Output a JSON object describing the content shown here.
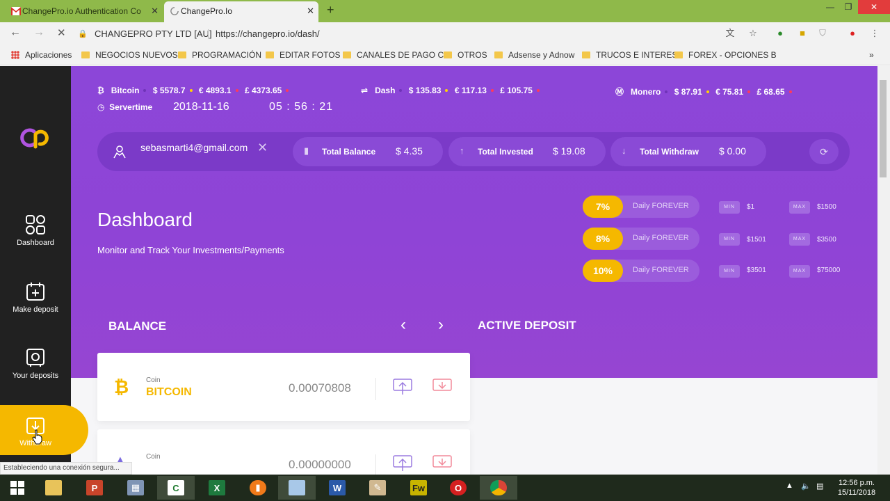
{
  "browser": {
    "tabs": [
      {
        "title": "ChangePro.io Authentication Co",
        "icon": "gmail-icon"
      },
      {
        "title": "ChangePro.Io",
        "icon": "loading-icon"
      }
    ],
    "org": "CHANGEPRO PTY LTD [AU]",
    "url": "https://changepro.io/dash/",
    "bookmarks": [
      "Aplicaciones",
      "NEGOCIOS NUEVOS",
      "PROGRAMACIÓN",
      "EDITAR FOTOS",
      "CANALES DE PAGO C",
      "OTROS",
      "Adsense y Adnow",
      "TRUCOS E INTERES",
      "FOREX - OPCIONES B"
    ],
    "status": "Estableciendo una conexión segura..."
  },
  "ticker": {
    "bitcoin": {
      "name": "Bitcoin",
      "usd": "$ 5578.7",
      "eur": "€ 4893.1",
      "gbp": "£ 4373.65"
    },
    "dash": {
      "name": "Dash",
      "usd": "$ 135.83",
      "eur": "€ 117.13",
      "gbp": "£ 105.75"
    },
    "monero": {
      "name": "Monero",
      "usd": "$ 87.91",
      "eur": "€ 75.81",
      "gbp": "£ 68.65"
    },
    "servertime_label": "Servertime",
    "date": "2018-11-16",
    "time": "05 : 56 : 21"
  },
  "user": {
    "email": "sebasmarti4@gmail.com",
    "total_balance_label": "Total Balance",
    "total_balance": "$ 4.35",
    "total_invested_label": "Total Invested",
    "total_invested": "$ 19.08",
    "total_withdraw_label": "Total Withdraw",
    "total_withdraw": "$ 0.00"
  },
  "sidebar": {
    "items": [
      "Dashboard",
      "Make deposit",
      "Your deposits",
      "Withdraw"
    ]
  },
  "header": {
    "title": "Dashboard",
    "subtitle": "Monitor and Track Your Investments/Payments"
  },
  "plans": [
    {
      "pct": "7%",
      "label": "Daily FOREVER",
      "min_label": "MIN",
      "min": "$1",
      "max_label": "MAX",
      "max": "$1500"
    },
    {
      "pct": "8%",
      "label": "Daily FOREVER",
      "min_label": "MIN",
      "min": "$1501",
      "max_label": "MAX",
      "max": "$3500"
    },
    {
      "pct": "10%",
      "label": "Daily FOREVER",
      "min_label": "MIN",
      "min": "$3501",
      "max_label": "MAX",
      "max": "$75000"
    }
  ],
  "sections": {
    "balance": "BALANCE",
    "active_deposit": "ACTIVE DEPOSIT"
  },
  "coins": [
    {
      "label": "Coin",
      "name": "BITCOIN",
      "amount": "0.00070808"
    },
    {
      "label": "Coin",
      "name": "",
      "amount": "0.00000000"
    }
  ],
  "taskbar": {
    "clock_time": "12:56 p.m.",
    "clock_date": "15/11/2018"
  },
  "colors": {
    "accent": "#8c46d8",
    "gold": "#f5b800",
    "sidebar": "#212121"
  }
}
